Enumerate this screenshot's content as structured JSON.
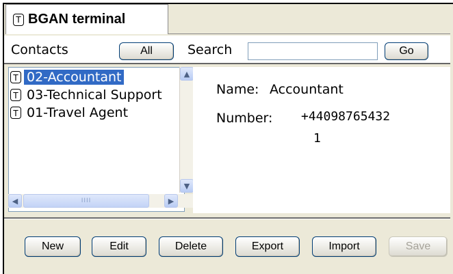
{
  "tab": {
    "badge": "T",
    "title": "BGAN terminal"
  },
  "toolbar": {
    "contacts_label": "Contacts",
    "all_button": "All",
    "search_label": "Search",
    "search_value": "",
    "go_button": "Go"
  },
  "contacts": [
    {
      "badge": "T",
      "label": "02-Accountant",
      "selected": true
    },
    {
      "badge": "T",
      "label": "03-Technical Support",
      "selected": false
    },
    {
      "badge": "T",
      "label": "01-Travel Agent",
      "selected": false
    }
  ],
  "scroll": {
    "up": "▲",
    "down": "▼",
    "left": "◀",
    "right": "▶",
    "grip": "IIII"
  },
  "details": {
    "name_label": "Name:",
    "name_value": "Accountant",
    "number_label": "Number:",
    "number_line1": "+44098765432",
    "number_line2": "1"
  },
  "actions": {
    "new": "New",
    "edit": "Edit",
    "delete": "Delete",
    "export": "Export",
    "import": "Import",
    "save": "Save"
  }
}
